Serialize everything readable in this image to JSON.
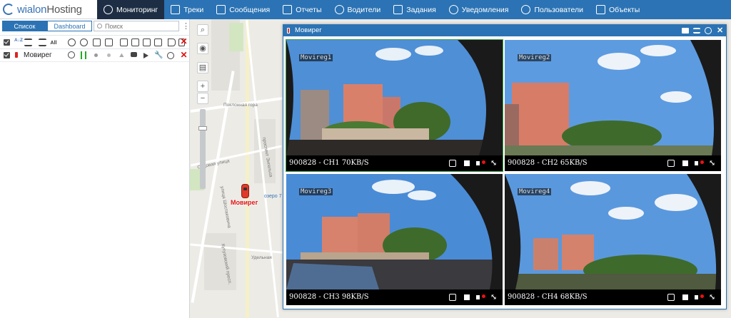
{
  "app": {
    "logo_brand": "wialon",
    "logo_suffix": "Hosting"
  },
  "nav": {
    "items": [
      {
        "label": "Мониторинг",
        "icon": "monitoring-globe-icon",
        "active": true
      },
      {
        "label": "Треки",
        "icon": "tracks-flag-icon"
      },
      {
        "label": "Сообщения",
        "icon": "messages-icon"
      },
      {
        "label": "Отчеты",
        "icon": "reports-icon"
      },
      {
        "label": "Водители",
        "icon": "drivers-wheel-icon"
      },
      {
        "label": "Задания",
        "icon": "jobs-checklist-icon"
      },
      {
        "label": "Уведомления",
        "icon": "notifications-alarm-icon"
      },
      {
        "label": "Пользователи",
        "icon": "users-icon"
      },
      {
        "label": "Объекты",
        "icon": "units-bus-icon"
      }
    ]
  },
  "left": {
    "tab_list": "Список",
    "tab_dashboard": "Dashboard",
    "search_placeholder": "Поиск",
    "toolbar_az": "A↓Z",
    "toolbar_all": "All",
    "unit_name": "Мовирег"
  },
  "map": {
    "unit_label": "Мовирег",
    "lake_label": "озеро 7",
    "street_labels": [
      "Поклонная гора",
      "Садовая улица",
      "Кутузовский просп.",
      "Удельная",
      "проспект Энгельса",
      "улица Шостаковича"
    ]
  },
  "video_window": {
    "title": "Мовирег",
    "cameras": [
      {
        "overlay": "Movireg1",
        "caption": "900828 - CH1 70KB/S",
        "selected": true
      },
      {
        "overlay": "Movireg2",
        "caption": "900828 - CH2 65KB/S",
        "selected": false
      },
      {
        "overlay": "Movireg3",
        "caption": "900828 - CH3 98KB/S",
        "selected": false
      },
      {
        "overlay": "Movireg4",
        "caption": "900828 - CH4 68KB/S",
        "selected": false
      }
    ]
  },
  "colors": {
    "accent": "#2b73b4",
    "nav_active": "#1d2e44",
    "selected_border": "#37a246",
    "danger": "#dd1111",
    "unit_marker": "#e23a2a"
  }
}
